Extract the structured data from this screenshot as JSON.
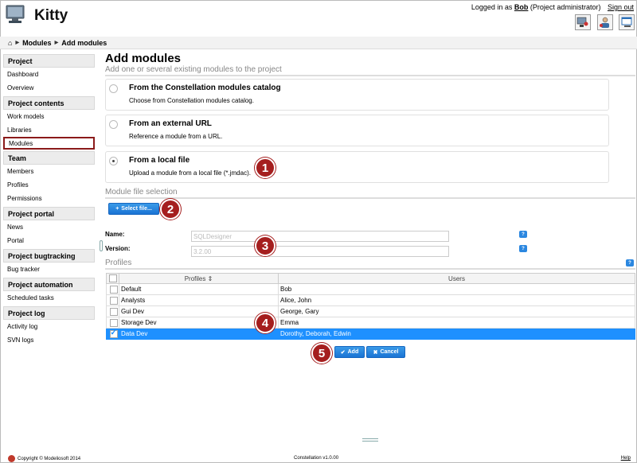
{
  "app": {
    "title": "Kitty"
  },
  "header": {
    "logged_in_prefix": "Logged in as",
    "user": "Bob",
    "role": "(Project administrator)",
    "signout": "Sign out"
  },
  "breadcrumb": {
    "items": [
      "Modules",
      "Add modules"
    ]
  },
  "sidebar": {
    "sections": [
      {
        "title": "Project",
        "items": [
          "Dashboard",
          "Overview"
        ]
      },
      {
        "title": "Project contents",
        "items": [
          "Work models",
          "Libraries",
          "Modules"
        ]
      },
      {
        "title": "Team",
        "items": [
          "Members",
          "Profiles",
          "Permissions"
        ]
      },
      {
        "title": "Project portal",
        "items": [
          "News",
          "Portal"
        ]
      },
      {
        "title": "Project bugtracking",
        "items": [
          "Bug tracker"
        ]
      },
      {
        "title": "Project automation",
        "items": [
          "Scheduled tasks"
        ]
      },
      {
        "title": "Project log",
        "items": [
          "Activity log",
          "SVN logs"
        ]
      }
    ],
    "active_item": "Modules"
  },
  "page": {
    "title": "Add modules",
    "subtitle": "Add one or several existing modules to the project"
  },
  "options": [
    {
      "title": "From the Constellation modules catalog",
      "desc": "Choose from Constellation modules catalog.",
      "selected": false
    },
    {
      "title": "From an external URL",
      "desc": "Reference a module from a URL.",
      "selected": false
    },
    {
      "title": "From a local file",
      "desc": "Upload a module from a local file (*.jmdac).",
      "selected": true
    }
  ],
  "file_section": {
    "title": "Module file selection",
    "select_button": "Select file..."
  },
  "fields": {
    "name_label": "Name:",
    "name_value": "SQLDesigner",
    "version_label": "Version:",
    "version_value": "3.2.00",
    "help": "?"
  },
  "profiles": {
    "title": "Profiles",
    "columns": [
      "Profiles",
      "Users"
    ],
    "rows": [
      {
        "profile": "Default",
        "users": "Bob",
        "checked": false,
        "selected": false
      },
      {
        "profile": "Analysts",
        "users": "Alice, John",
        "checked": false,
        "selected": false
      },
      {
        "profile": "Gui Dev",
        "users": "George, Gary",
        "checked": false,
        "selected": false
      },
      {
        "profile": "Storage Dev",
        "users": "Emma",
        "checked": false,
        "selected": false
      },
      {
        "profile": "Data Dev",
        "users": "Dorothy, Deborah, Edwin",
        "checked": true,
        "selected": true
      }
    ]
  },
  "actions": {
    "add": "Add",
    "cancel": "Cancel"
  },
  "markers": [
    "1",
    "2",
    "3",
    "4",
    "5"
  ],
  "footer": {
    "copyright": "Copyright © Modeliosoft 2014",
    "version": "Constellation v1.0.00",
    "help": "Help"
  },
  "colors": {
    "accent": "#1e90ff",
    "marker": "#a51e1e",
    "active_border": "#8b1a1a"
  }
}
